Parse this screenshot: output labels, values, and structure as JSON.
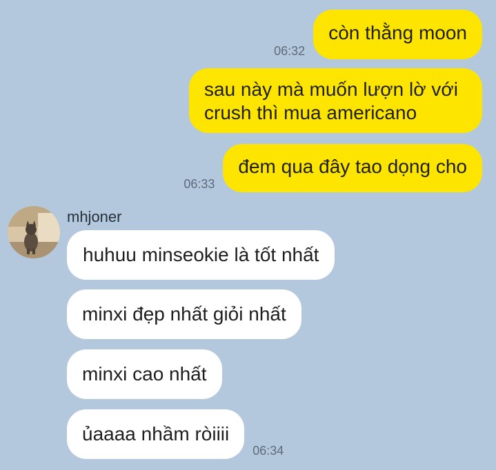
{
  "outgoing": [
    {
      "text": "còn thằng moon",
      "time": "06:32"
    },
    {
      "text": "sau này mà muốn lượn lờ với crush thì mua americano",
      "time": ""
    },
    {
      "text": "đem qua đây tao dọng cho",
      "time": "06:33"
    }
  ],
  "sender": {
    "name": "mhjoner",
    "avatar_icon": "cat-photo-avatar"
  },
  "incoming": [
    {
      "text": "huhuu minseokie là tốt nhất",
      "time": ""
    },
    {
      "text": "minxi đẹp nhất giỏi nhất",
      "time": ""
    },
    {
      "text": "minxi cao nhất",
      "time": ""
    },
    {
      "text": "ủaaaa nhầm ròiiii",
      "time": "06:34"
    }
  ],
  "colors": {
    "background": "#b3c7dd",
    "outgoing_bubble": "#fee500",
    "incoming_bubble": "#ffffff"
  }
}
